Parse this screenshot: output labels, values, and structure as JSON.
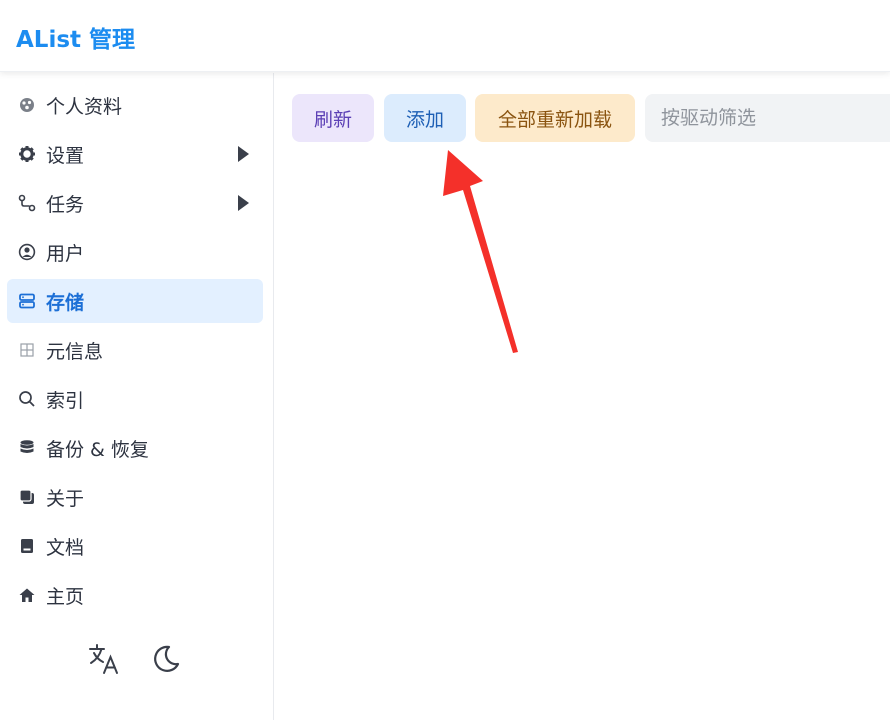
{
  "header": {
    "title": "AList 管理"
  },
  "sidebar": {
    "items": [
      {
        "label": "个人资料",
        "icon": "user-profile-icon"
      },
      {
        "label": "设置",
        "icon": "gear-icon"
      },
      {
        "label": "任务",
        "icon": "route-icon"
      },
      {
        "label": "用户",
        "icon": "user-circle-icon"
      },
      {
        "label": "存储",
        "icon": "storage-icon"
      },
      {
        "label": "元信息",
        "icon": "meta-icon"
      },
      {
        "label": "索引",
        "icon": "search-icon"
      },
      {
        "label": "备份 & 恢复",
        "icon": "database-icon"
      },
      {
        "label": "关于",
        "icon": "copy-icon"
      },
      {
        "label": "文档",
        "icon": "book-icon"
      },
      {
        "label": "主页",
        "icon": "home-icon"
      }
    ],
    "active_item": "存储"
  },
  "toolbar": {
    "refresh_label": "刷新",
    "add_label": "添加",
    "reload_all_label": "全部重新加载",
    "filter_placeholder": "按驱动筛选"
  },
  "colors": {
    "brand": "#1c8cf0",
    "active_bg": "#e3f0ff",
    "refresh_bg": "#ece6fb",
    "add_bg": "#dcecfd",
    "reload_bg": "#fdeacb",
    "annotation_arrow": "#f4302a"
  }
}
